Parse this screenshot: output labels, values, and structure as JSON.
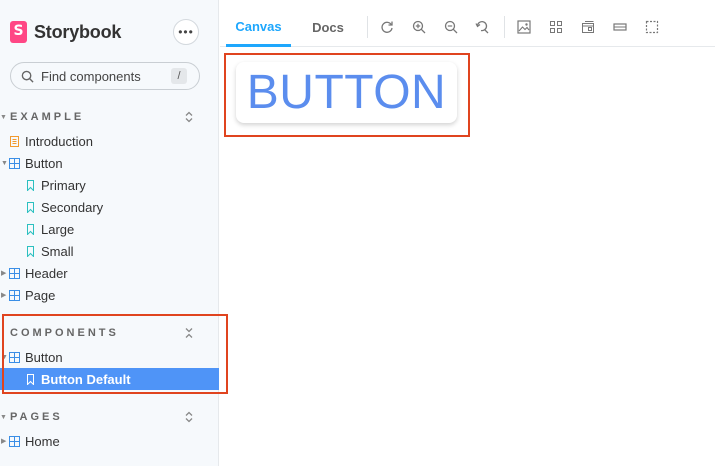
{
  "brand": {
    "name": "Storybook",
    "logo_letter": "S"
  },
  "sidebar": {
    "menu_label": "•••",
    "search": {
      "placeholder": "Find components",
      "shortcut": "/"
    },
    "sections": [
      {
        "title": "EXAMPLE",
        "toggle": "⌃⌄"
      },
      {
        "title": "COMPONENTS",
        "toggle": "⌄⌃"
      },
      {
        "title": "PAGES",
        "toggle": "⌃⌄"
      }
    ],
    "items": [
      {
        "label": "Introduction",
        "icon": "document-icon"
      },
      {
        "label": "Button",
        "icon": "component-icon"
      },
      {
        "label": "Primary",
        "icon": "bookmark-icon"
      },
      {
        "label": "Secondary",
        "icon": "bookmark-icon"
      },
      {
        "label": "Large",
        "icon": "bookmark-icon"
      },
      {
        "label": "Small",
        "icon": "bookmark-icon"
      },
      {
        "label": "Header",
        "icon": "component-icon"
      },
      {
        "label": "Page",
        "icon": "component-icon"
      },
      {
        "label": "Button",
        "icon": "component-icon"
      },
      {
        "label": "Button Default",
        "icon": "bookmark-icon",
        "selected": true
      },
      {
        "label": "Home",
        "icon": "component-icon"
      }
    ]
  },
  "toolbar": {
    "tabs": [
      {
        "label": "Canvas",
        "active": true
      },
      {
        "label": "Docs",
        "active": false
      }
    ],
    "icons": [
      "reload-icon",
      "zoom-in-icon",
      "zoom-out-icon",
      "zoom-reset-icon",
      "background-icon",
      "grid-icon",
      "viewport-icon",
      "measure-icon",
      "outline-icon"
    ]
  },
  "canvas": {
    "button_label": "BUTTON"
  },
  "colors": {
    "accent": "#1ea7fd",
    "selected": "#4f94f7",
    "highlight": "#e0441f",
    "brand": "#ff4785",
    "button_text": "#5b8dee"
  }
}
